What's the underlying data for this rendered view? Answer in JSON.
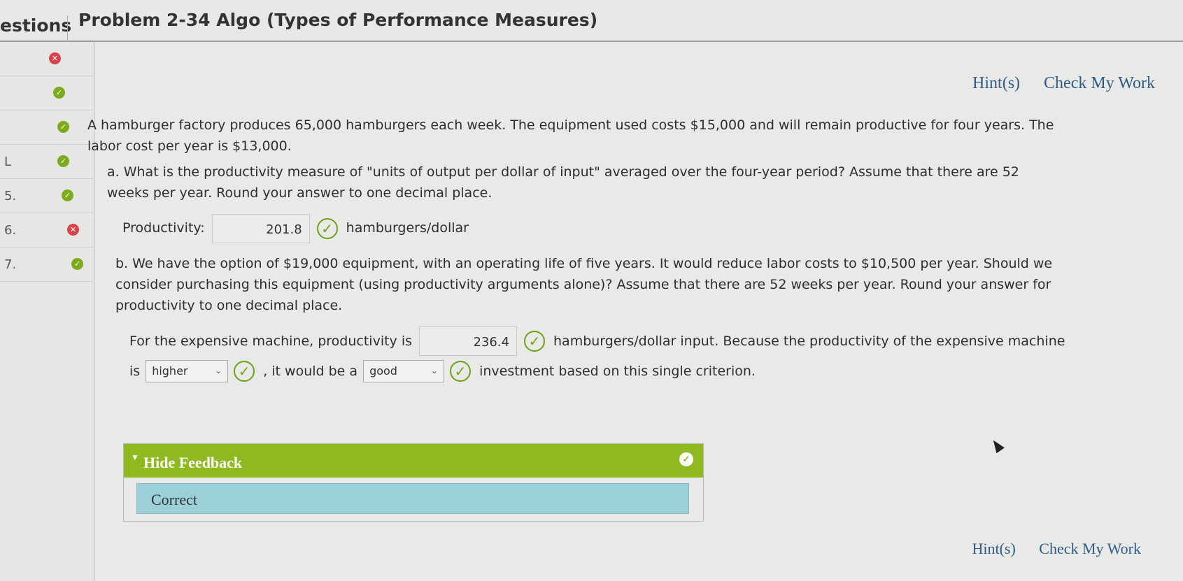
{
  "header": {
    "questions_tab": "estions",
    "problem_title": "Problem 2-34 Algo (Types of Performance Measures)"
  },
  "questions": [
    {
      "number": "",
      "status": "wrong"
    },
    {
      "number": "",
      "status": "correct"
    },
    {
      "number": "",
      "status": "correct"
    },
    {
      "number": "L",
      "status": "correct"
    },
    {
      "number": "5.",
      "status": "correct"
    },
    {
      "number": "6.",
      "status": "wrong"
    },
    {
      "number": "7.",
      "status": "correct"
    }
  ],
  "links": {
    "hints": "Hint(s)",
    "check": "Check My Work"
  },
  "problem": {
    "intro": "A hamburger factory produces 65,000 hamburgers each week. The equipment used costs $15,000 and will remain productive for four years. The labor cost per year is $13,000.",
    "part_a": "a. What is the productivity measure of \"units of output per dollar of input\" averaged over the four-year period? Assume that there are 52 weeks per year. Round your answer to one decimal place.",
    "part_a_label": "Productivity:",
    "part_a_value": "201.8",
    "part_a_unit": "hamburgers/dollar",
    "part_b": "b. We have the option of $19,000 equipment, with an operating life of five years. It would reduce labor costs to $10,500 per year. Should we consider purchasing this equipment (using productivity arguments alone)? Assume that there are 52 weeks per year. Round your answer for productivity to one decimal place.",
    "part_b_prefix": "For the expensive machine, productivity is",
    "part_b_value": "236.4",
    "part_b_suffix": "hamburgers/dollar input. Because the productivity of the expensive machine",
    "is_label": "is",
    "select1": "higher",
    "mid_text": ", it would be a",
    "select2": "good",
    "end_text": "investment based on this single criterion."
  },
  "feedback": {
    "toggle": "Hide Feedback",
    "message": "Correct"
  },
  "icons": {
    "check": "check-circle-icon",
    "wrong": "x-circle-icon"
  },
  "colors": {
    "correct": "#7cab1d",
    "wrong": "#d8434a",
    "link": "#2d5c88",
    "feedback_bar": "#8fba1f",
    "feedback_body": "#9bd0d8"
  }
}
